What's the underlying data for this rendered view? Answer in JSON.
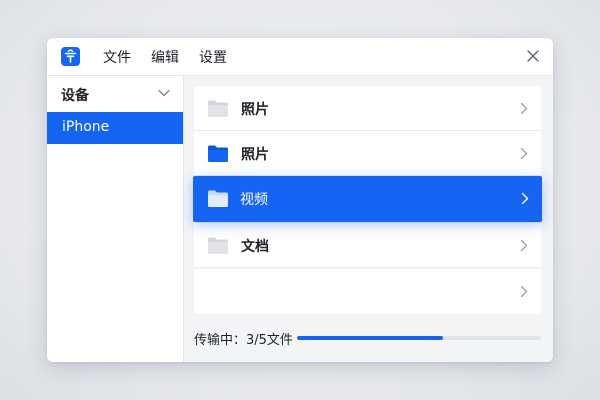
{
  "menu": {
    "items": [
      "文件",
      "编辑",
      "设置"
    ]
  },
  "icons": {
    "app": "app-logo-icon",
    "close": "close-icon",
    "expand": "chevron-down-icon",
    "folder": "folder-icon",
    "row_arrow": "chevron-right-icon"
  },
  "sidebar": {
    "header": "设备",
    "items": [
      {
        "label": "iPhone",
        "selected": true
      }
    ]
  },
  "folders": [
    {
      "label": "照片",
      "icon_color": "#d4d6db",
      "selected": false
    },
    {
      "label": "照片",
      "icon_color": "#1565f2",
      "selected": false
    },
    {
      "label": "视频",
      "icon_color": "#dfe8f8",
      "selected": true
    },
    {
      "label": "文档",
      "icon_color": "#d4d6db",
      "selected": false
    },
    {
      "label": "",
      "icon_color": "",
      "selected": false
    }
  ],
  "progress": {
    "label": "传输中：3/5文件",
    "done": 3,
    "total": 5
  },
  "colors": {
    "accent": "#1565f2",
    "background": "#e6e8ec",
    "panel": "#f3f4f6"
  }
}
